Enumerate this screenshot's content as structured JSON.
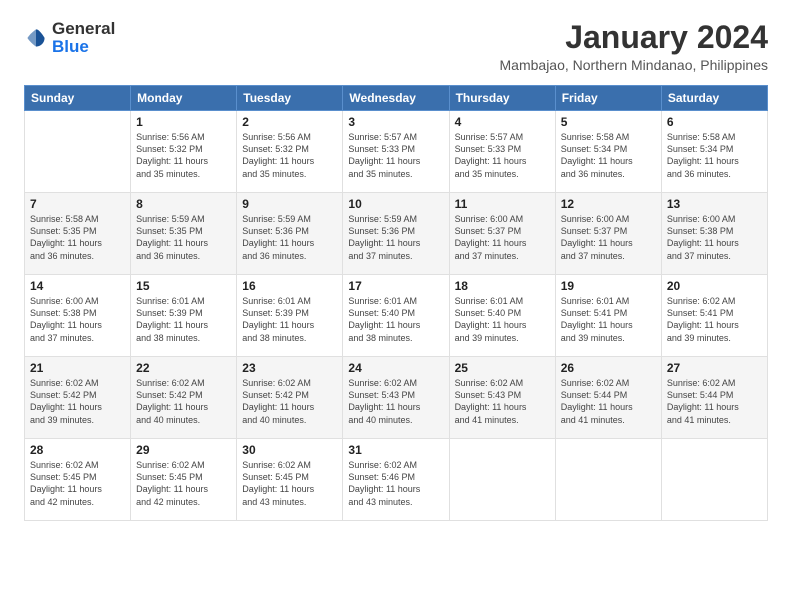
{
  "header": {
    "logo_general": "General",
    "logo_blue": "Blue",
    "month_title": "January 2024",
    "subtitle": "Mambajao, Northern Mindanao, Philippines"
  },
  "weekdays": [
    "Sunday",
    "Monday",
    "Tuesday",
    "Wednesday",
    "Thursday",
    "Friday",
    "Saturday"
  ],
  "weeks": [
    [
      {
        "day": "",
        "info": ""
      },
      {
        "day": "1",
        "info": "Sunrise: 5:56 AM\nSunset: 5:32 PM\nDaylight: 11 hours\nand 35 minutes."
      },
      {
        "day": "2",
        "info": "Sunrise: 5:56 AM\nSunset: 5:32 PM\nDaylight: 11 hours\nand 35 minutes."
      },
      {
        "day": "3",
        "info": "Sunrise: 5:57 AM\nSunset: 5:33 PM\nDaylight: 11 hours\nand 35 minutes."
      },
      {
        "day": "4",
        "info": "Sunrise: 5:57 AM\nSunset: 5:33 PM\nDaylight: 11 hours\nand 35 minutes."
      },
      {
        "day": "5",
        "info": "Sunrise: 5:58 AM\nSunset: 5:34 PM\nDaylight: 11 hours\nand 36 minutes."
      },
      {
        "day": "6",
        "info": "Sunrise: 5:58 AM\nSunset: 5:34 PM\nDaylight: 11 hours\nand 36 minutes."
      }
    ],
    [
      {
        "day": "7",
        "info": "Sunrise: 5:58 AM\nSunset: 5:35 PM\nDaylight: 11 hours\nand 36 minutes."
      },
      {
        "day": "8",
        "info": "Sunrise: 5:59 AM\nSunset: 5:35 PM\nDaylight: 11 hours\nand 36 minutes."
      },
      {
        "day": "9",
        "info": "Sunrise: 5:59 AM\nSunset: 5:36 PM\nDaylight: 11 hours\nand 36 minutes."
      },
      {
        "day": "10",
        "info": "Sunrise: 5:59 AM\nSunset: 5:36 PM\nDaylight: 11 hours\nand 37 minutes."
      },
      {
        "day": "11",
        "info": "Sunrise: 6:00 AM\nSunset: 5:37 PM\nDaylight: 11 hours\nand 37 minutes."
      },
      {
        "day": "12",
        "info": "Sunrise: 6:00 AM\nSunset: 5:37 PM\nDaylight: 11 hours\nand 37 minutes."
      },
      {
        "day": "13",
        "info": "Sunrise: 6:00 AM\nSunset: 5:38 PM\nDaylight: 11 hours\nand 37 minutes."
      }
    ],
    [
      {
        "day": "14",
        "info": "Sunrise: 6:00 AM\nSunset: 5:38 PM\nDaylight: 11 hours\nand 37 minutes."
      },
      {
        "day": "15",
        "info": "Sunrise: 6:01 AM\nSunset: 5:39 PM\nDaylight: 11 hours\nand 38 minutes."
      },
      {
        "day": "16",
        "info": "Sunrise: 6:01 AM\nSunset: 5:39 PM\nDaylight: 11 hours\nand 38 minutes."
      },
      {
        "day": "17",
        "info": "Sunrise: 6:01 AM\nSunset: 5:40 PM\nDaylight: 11 hours\nand 38 minutes."
      },
      {
        "day": "18",
        "info": "Sunrise: 6:01 AM\nSunset: 5:40 PM\nDaylight: 11 hours\nand 39 minutes."
      },
      {
        "day": "19",
        "info": "Sunrise: 6:01 AM\nSunset: 5:41 PM\nDaylight: 11 hours\nand 39 minutes."
      },
      {
        "day": "20",
        "info": "Sunrise: 6:02 AM\nSunset: 5:41 PM\nDaylight: 11 hours\nand 39 minutes."
      }
    ],
    [
      {
        "day": "21",
        "info": "Sunrise: 6:02 AM\nSunset: 5:42 PM\nDaylight: 11 hours\nand 39 minutes."
      },
      {
        "day": "22",
        "info": "Sunrise: 6:02 AM\nSunset: 5:42 PM\nDaylight: 11 hours\nand 40 minutes."
      },
      {
        "day": "23",
        "info": "Sunrise: 6:02 AM\nSunset: 5:42 PM\nDaylight: 11 hours\nand 40 minutes."
      },
      {
        "day": "24",
        "info": "Sunrise: 6:02 AM\nSunset: 5:43 PM\nDaylight: 11 hours\nand 40 minutes."
      },
      {
        "day": "25",
        "info": "Sunrise: 6:02 AM\nSunset: 5:43 PM\nDaylight: 11 hours\nand 41 minutes."
      },
      {
        "day": "26",
        "info": "Sunrise: 6:02 AM\nSunset: 5:44 PM\nDaylight: 11 hours\nand 41 minutes."
      },
      {
        "day": "27",
        "info": "Sunrise: 6:02 AM\nSunset: 5:44 PM\nDaylight: 11 hours\nand 41 minutes."
      }
    ],
    [
      {
        "day": "28",
        "info": "Sunrise: 6:02 AM\nSunset: 5:45 PM\nDaylight: 11 hours\nand 42 minutes."
      },
      {
        "day": "29",
        "info": "Sunrise: 6:02 AM\nSunset: 5:45 PM\nDaylight: 11 hours\nand 42 minutes."
      },
      {
        "day": "30",
        "info": "Sunrise: 6:02 AM\nSunset: 5:45 PM\nDaylight: 11 hours\nand 43 minutes."
      },
      {
        "day": "31",
        "info": "Sunrise: 6:02 AM\nSunset: 5:46 PM\nDaylight: 11 hours\nand 43 minutes."
      },
      {
        "day": "",
        "info": ""
      },
      {
        "day": "",
        "info": ""
      },
      {
        "day": "",
        "info": ""
      }
    ]
  ]
}
